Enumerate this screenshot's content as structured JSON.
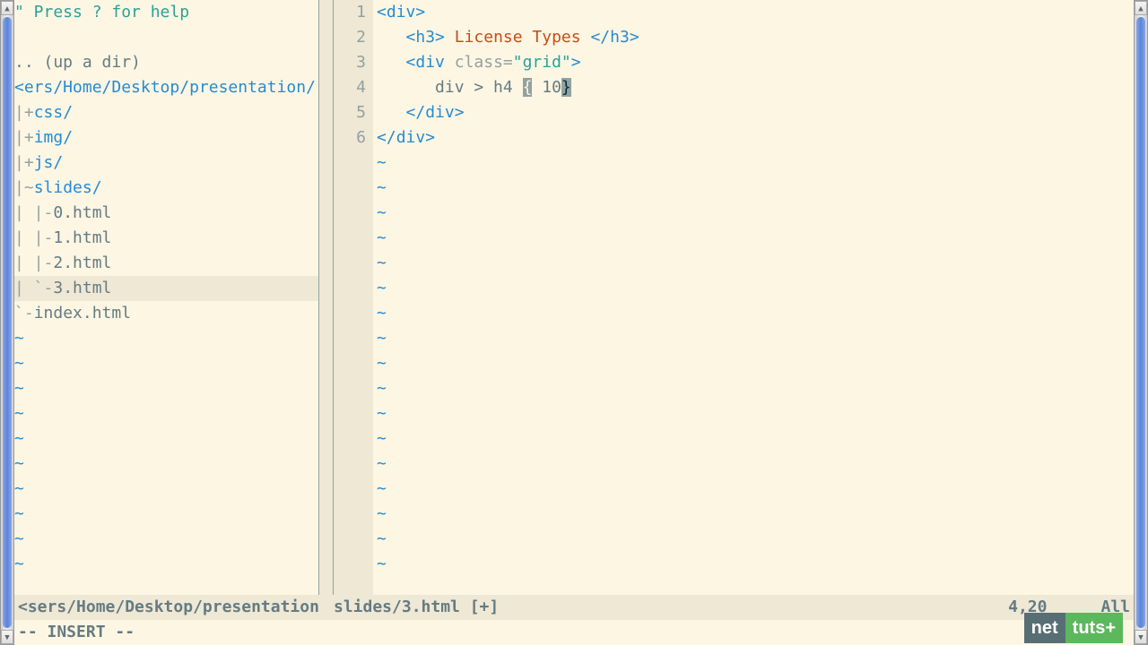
{
  "nerdtree": {
    "help": "\" Press ? for help",
    "updir": ".. (up a dir)",
    "root": "<ers/Home/Desktop/presentation/",
    "items": [
      {
        "prefix": "|+",
        "name": "css/",
        "type": "dir"
      },
      {
        "prefix": "|+",
        "name": "img/",
        "type": "dir"
      },
      {
        "prefix": "|+",
        "name": "js/",
        "type": "dir"
      },
      {
        "prefix": "|~",
        "name": "slides/",
        "type": "dir"
      },
      {
        "prefix": "| |-",
        "name": "0.html",
        "type": "file"
      },
      {
        "prefix": "| |-",
        "name": "1.html",
        "type": "file"
      },
      {
        "prefix": "| |-",
        "name": "2.html",
        "type": "file"
      },
      {
        "prefix": "| `-",
        "name": "3.html",
        "type": "file",
        "selected": true
      },
      {
        "prefix": "`-",
        "name": "index.html",
        "type": "file"
      }
    ]
  },
  "code": {
    "lines": [
      {
        "n": 1,
        "segments": [
          {
            "t": "<",
            "c": "tag"
          },
          {
            "t": "div",
            "c": "tagname"
          },
          {
            "t": ">",
            "c": "tag"
          }
        ]
      },
      {
        "n": 2,
        "segments": [
          {
            "t": "   ",
            "c": "plain"
          },
          {
            "t": "<",
            "c": "tag"
          },
          {
            "t": "h3",
            "c": "tagname"
          },
          {
            "t": ">",
            "c": "tag"
          },
          {
            "t": " License Types ",
            "c": "text"
          },
          {
            "t": "</",
            "c": "tag"
          },
          {
            "t": "h3",
            "c": "tagname"
          },
          {
            "t": ">",
            "c": "tag"
          }
        ]
      },
      {
        "n": 3,
        "segments": [
          {
            "t": "   ",
            "c": "plain"
          },
          {
            "t": "<",
            "c": "tag"
          },
          {
            "t": "div ",
            "c": "tagname"
          },
          {
            "t": "class=",
            "c": "attr"
          },
          {
            "t": "\"grid\"",
            "c": "string"
          },
          {
            "t": ">",
            "c": "tag"
          }
        ]
      },
      {
        "n": 4,
        "segments": [
          {
            "t": "      div > h4 ",
            "c": "plain"
          },
          {
            "t": "{",
            "c": "cursor-brace"
          },
          {
            "t": " 10",
            "c": "plain"
          },
          {
            "t": "}",
            "c": "cursor-cell"
          }
        ]
      },
      {
        "n": 5,
        "segments": [
          {
            "t": "   ",
            "c": "plain"
          },
          {
            "t": "</",
            "c": "tag"
          },
          {
            "t": "div",
            "c": "tagname"
          },
          {
            "t": ">",
            "c": "tag"
          }
        ]
      },
      {
        "n": 6,
        "segments": [
          {
            "t": "</",
            "c": "tag"
          },
          {
            "t": "div",
            "c": "tagname"
          },
          {
            "t": ">",
            "c": "tag"
          }
        ]
      }
    ],
    "empty_rows": 17
  },
  "status": {
    "left": "<sers/Home/Desktop/presentation",
    "file": "slides/3.html [+]",
    "pos": "4,20",
    "pct": "All"
  },
  "mode": "-- INSERT --",
  "logo": {
    "a": "net",
    "b": "tuts+"
  }
}
